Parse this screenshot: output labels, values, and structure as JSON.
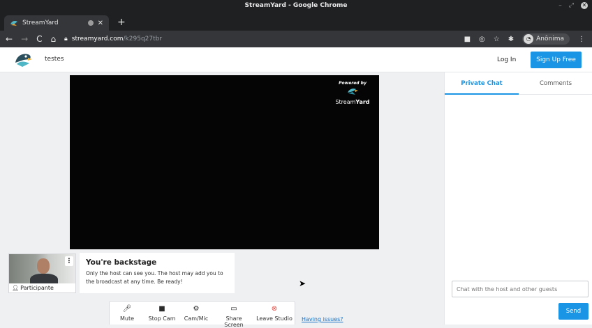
{
  "window": {
    "title": "StreamYard - Google Chrome"
  },
  "tab": {
    "title": "StreamYard"
  },
  "omnibox": {
    "host": "streamyard.com",
    "path": "/k295q27tbr"
  },
  "profile": {
    "name": "Anônima"
  },
  "app": {
    "studio_name": "testes",
    "login_label": "Log In",
    "signup_label": "Sign Up Free"
  },
  "stage": {
    "powered_by": "Powered by",
    "brand_a": "Stream",
    "brand_b": "Yard"
  },
  "participant": {
    "label": "Participante"
  },
  "backstage": {
    "title": "You're backstage",
    "line1": "Only the host can see you. The host may add you to",
    "line2": "the broadcast at any time. Be ready!"
  },
  "controls": [
    {
      "label": "Mute",
      "icon": "microphone-icon"
    },
    {
      "label": "Stop Cam",
      "icon": "camera-icon"
    },
    {
      "label": "Cam/Mic",
      "icon": "gear-icon"
    },
    {
      "label": "Share Screen",
      "icon": "monitor-icon"
    },
    {
      "label": "Leave Studio",
      "icon": "close-circle-icon",
      "color": "#e5483f"
    }
  ],
  "issues_link": "Having issues?",
  "sidebar": {
    "tabs": [
      "Private Chat",
      "Comments"
    ],
    "chat_placeholder": "Chat with the host and other guests",
    "send_label": "Send"
  },
  "colors": {
    "accent": "#1a95e5",
    "stage_bg": "#050505",
    "page_bg": "#eff0f1"
  }
}
